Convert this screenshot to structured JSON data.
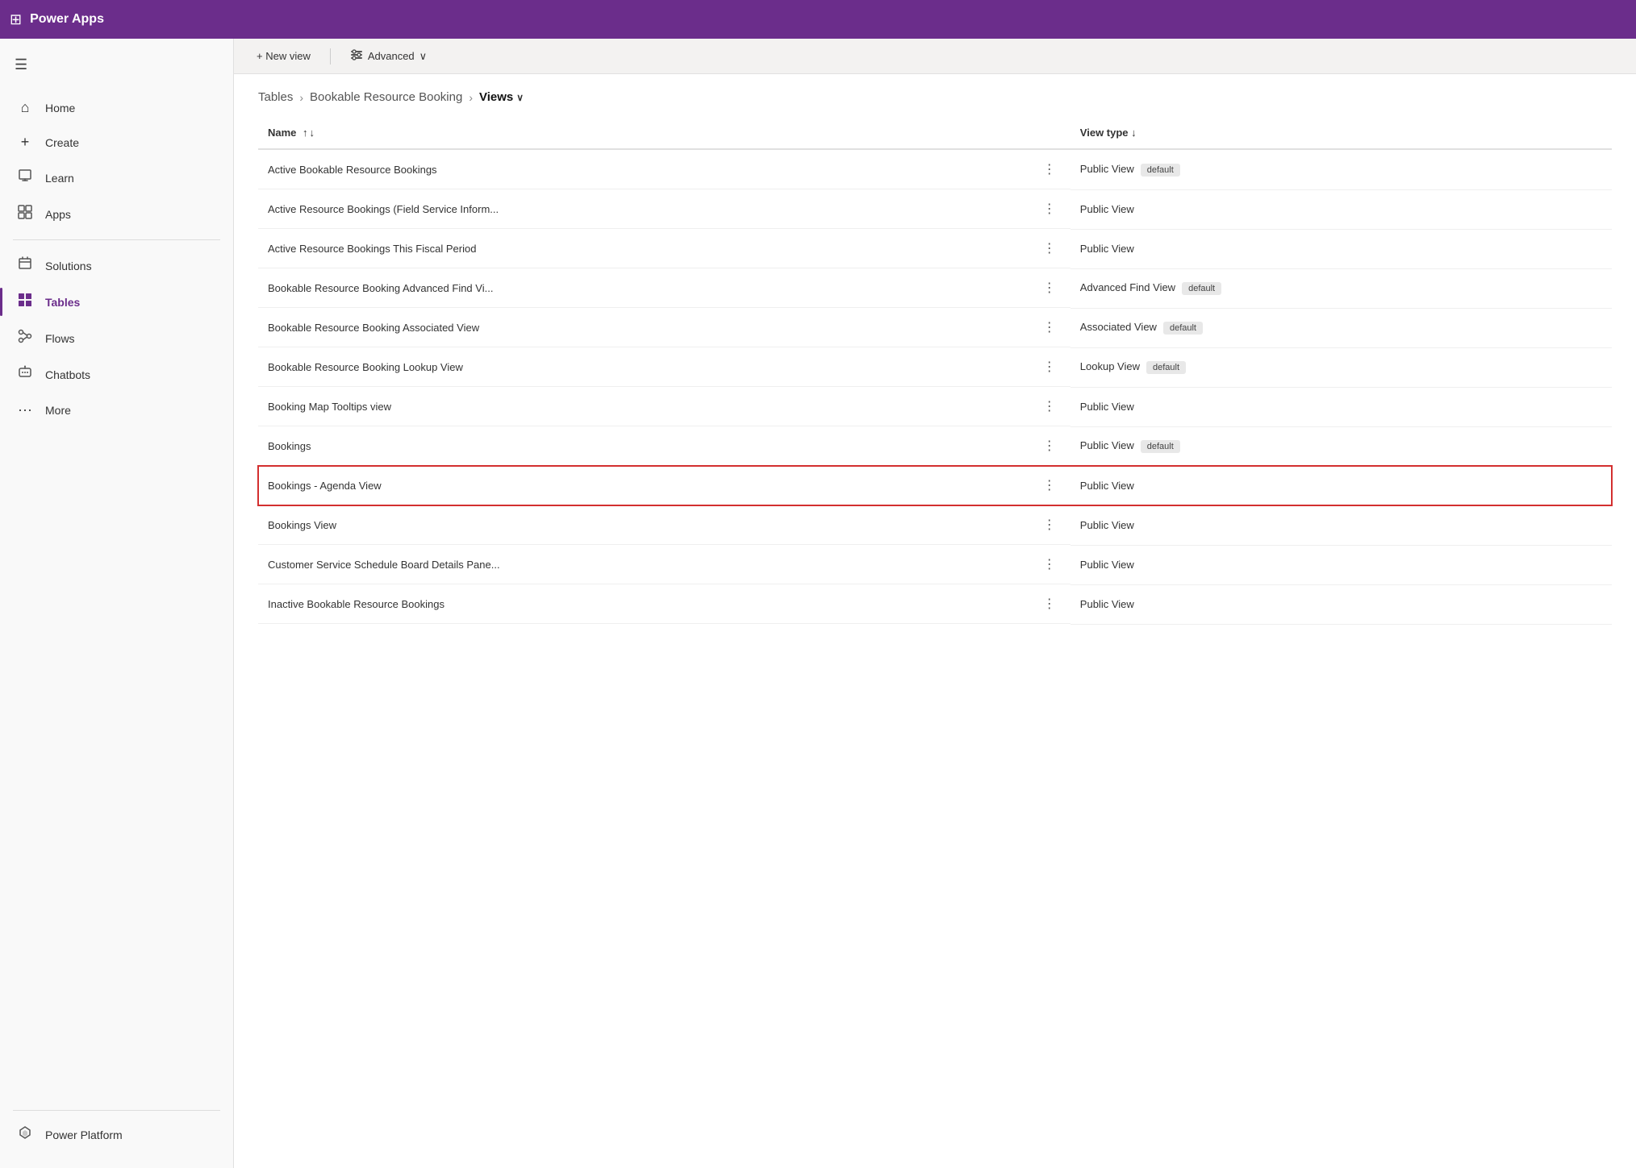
{
  "app": {
    "title": "Power Apps",
    "waffle": "⊞"
  },
  "sidebar": {
    "hamburger": "☰",
    "items": [
      {
        "id": "home",
        "label": "Home",
        "icon": "⌂",
        "active": false
      },
      {
        "id": "create",
        "label": "Create",
        "icon": "+",
        "active": false
      },
      {
        "id": "learn",
        "label": "Learn",
        "icon": "📖",
        "active": false
      },
      {
        "id": "apps",
        "label": "Apps",
        "icon": "🎁",
        "active": false
      },
      {
        "id": "solutions",
        "label": "Solutions",
        "icon": "🗂",
        "active": false
      },
      {
        "id": "tables",
        "label": "Tables",
        "icon": "⊞",
        "active": true
      },
      {
        "id": "flows",
        "label": "Flows",
        "icon": "⚙",
        "active": false
      },
      {
        "id": "chatbots",
        "label": "Chatbots",
        "icon": "🤖",
        "active": false
      },
      {
        "id": "more",
        "label": "More",
        "icon": "···",
        "active": false
      }
    ],
    "bottom_item": {
      "id": "power-platform",
      "label": "Power Platform",
      "icon": "⬡"
    }
  },
  "toolbar": {
    "new_view_label": "+ New view",
    "advanced_label": "Advanced",
    "advanced_icon": "🎛"
  },
  "breadcrumb": {
    "tables_label": "Tables",
    "sep1": "›",
    "booking_label": "Bookable Resource Booking",
    "sep2": "›",
    "current_label": "Views",
    "dropdown_icon": "∨"
  },
  "table": {
    "col_name": "Name",
    "col_type": "View type",
    "sort_asc": "↑",
    "sort_desc": "↓",
    "type_sort_down": "↓",
    "rows": [
      {
        "id": 1,
        "name": "Active Bookable Resource Bookings",
        "type": "Public View",
        "badges": [
          "default"
        ],
        "highlighted": false
      },
      {
        "id": 2,
        "name": "Active Resource Bookings (Field Service Inform...",
        "type": "Public View",
        "badges": [],
        "highlighted": false
      },
      {
        "id": 3,
        "name": "Active Resource Bookings This Fiscal Period",
        "type": "Public View",
        "badges": [],
        "highlighted": false
      },
      {
        "id": 4,
        "name": "Bookable Resource Booking Advanced Find Vi...",
        "type": "Advanced Find View",
        "badges": [
          "default"
        ],
        "highlighted": false
      },
      {
        "id": 5,
        "name": "Bookable Resource Booking Associated View",
        "type": "Associated View",
        "badges": [
          "default"
        ],
        "highlighted": false
      },
      {
        "id": 6,
        "name": "Bookable Resource Booking Lookup View",
        "type": "Lookup View",
        "badges": [
          "default"
        ],
        "highlighted": false
      },
      {
        "id": 7,
        "name": "Booking Map Tooltips view",
        "type": "Public View",
        "badges": [],
        "highlighted": false
      },
      {
        "id": 8,
        "name": "Bookings",
        "type": "Public View",
        "badges": [
          "default"
        ],
        "highlighted": false
      },
      {
        "id": 9,
        "name": "Bookings - Agenda View",
        "type": "Public View",
        "badges": [],
        "highlighted": true
      },
      {
        "id": 10,
        "name": "Bookings View",
        "type": "Public View",
        "badges": [],
        "highlighted": false
      },
      {
        "id": 11,
        "name": "Customer Service Schedule Board Details Pane...",
        "type": "Public View",
        "badges": [],
        "highlighted": false
      },
      {
        "id": 12,
        "name": "Inactive Bookable Resource Bookings",
        "type": "Public View",
        "badges": [],
        "highlighted": false
      }
    ]
  }
}
